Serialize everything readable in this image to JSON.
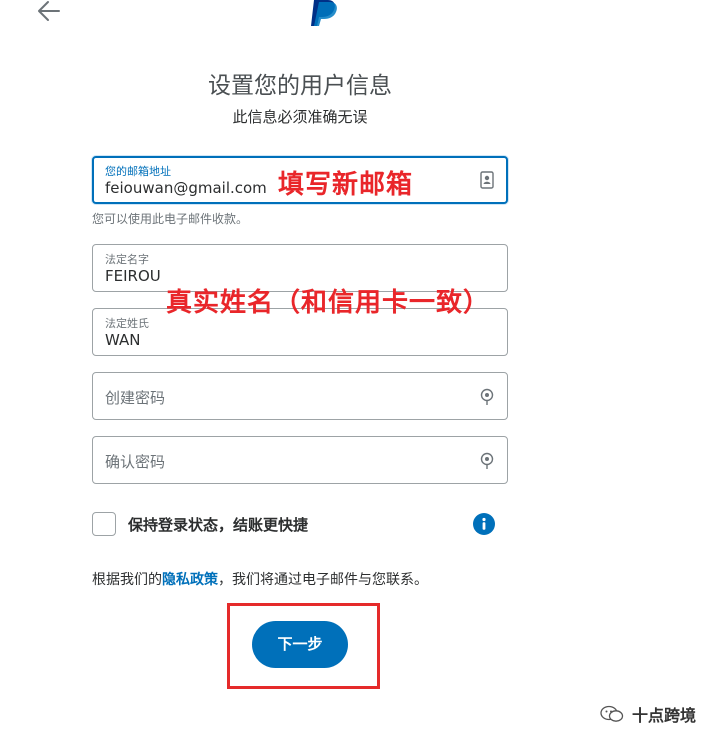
{
  "header": {
    "back_icon": "arrow-left-icon",
    "logo": "paypal-logo"
  },
  "title": "设置您的用户信息",
  "subtitle": "此信息必须准确无误",
  "email_field": {
    "label": "您的邮箱地址",
    "value": "feiouwan@gmail.com",
    "icon": "contact-card-icon"
  },
  "email_hint": "您可以使用此电子邮件收款。",
  "first_name_field": {
    "label": "法定名字",
    "value": "FEIROU"
  },
  "last_name_field": {
    "label": "法定姓氏",
    "value": "WAN"
  },
  "password_field": {
    "placeholder": "创建密码",
    "icon": "password-visibility-icon"
  },
  "confirm_password_field": {
    "placeholder": "确认密码",
    "icon": "password-visibility-icon"
  },
  "stay_logged_in": {
    "label": "保持登录状态，结账更快捷",
    "checked": false,
    "info_icon": "info-icon"
  },
  "policy": {
    "prefix": "根据我们的",
    "link": "隐私政策",
    "suffix": "，我们将通过电子邮件与您联系。"
  },
  "next_button": "下一步",
  "annotations": {
    "email_note": "填写新邮箱",
    "name_note": "真实姓名（和信用卡一致）"
  },
  "watermark": "十点跨境",
  "colors": {
    "primary": "#0070ba",
    "annotation": "#e9262a"
  }
}
